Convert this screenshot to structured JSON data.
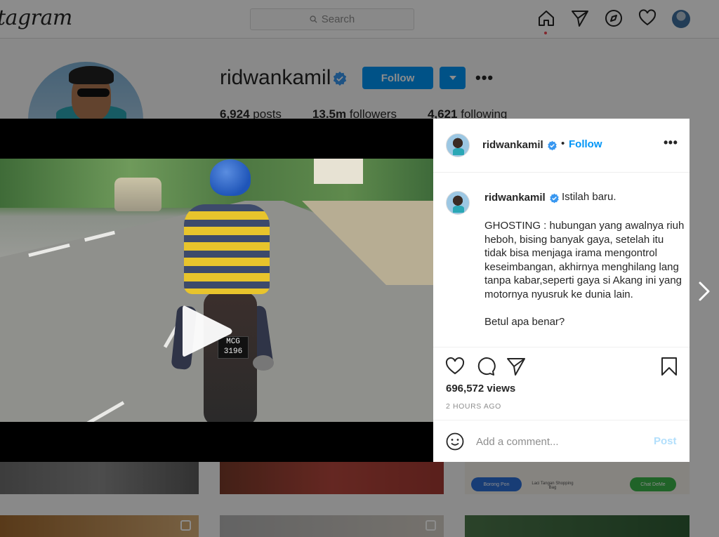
{
  "topbar": {
    "logo": "tagram",
    "search_placeholder": "Search",
    "icons": [
      "home-icon",
      "direct-icon",
      "explore-icon",
      "activity-heart-icon",
      "profile-avatar"
    ]
  },
  "profile": {
    "username": "ridwankamil",
    "follow_label": "Follow",
    "posts_count": "6,924",
    "posts_label": "posts",
    "followers_count": "13.5m",
    "followers_label": "followers",
    "following_count": "4,621",
    "following_label": "following"
  },
  "grid": {
    "pill_left": "Borong Pon",
    "pill_right": "Chat DeMe",
    "caption_mid": "Laci Tangan Shopping Bag"
  },
  "video": {
    "plate": "MCG 3196"
  },
  "post": {
    "username": "ridwankamil",
    "separator": "•",
    "follow_label": "Follow",
    "caption_first": "Istilah baru.",
    "caption_body": "GHOSTING : hubungan yang awalnya riuh heboh, bising banyak gaya, setelah itu tidak bisa menjaga irama mengontrol keseimbangan, akhirnya menghilang lang tanpa kabar,seperti gaya si Akang ini yang motornya nyusruk ke dunia lain.\n\nBetul apa benar?",
    "views": "696,572 views",
    "time": "2 HOURS AGO",
    "comment_placeholder": "Add a comment...",
    "post_label": "Post"
  },
  "colors": {
    "accent": "#0095f6",
    "post_disabled": "#b2dffc",
    "verified": "#3897f0"
  }
}
